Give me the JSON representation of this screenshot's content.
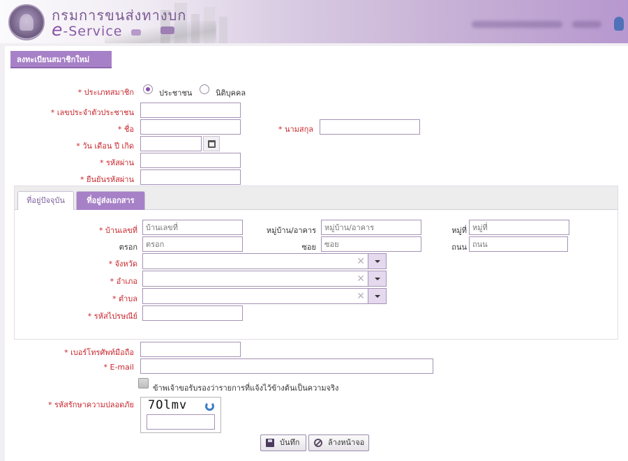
{
  "header": {
    "dept_name": "กรมการขนส่งทางบก",
    "service_prefix": "e",
    "service_suffix": "-Service"
  },
  "form": {
    "title": "ลงทะเบียนสมาชิกใหม่",
    "required_mark": "*",
    "member_type": {
      "label": "ประเภทสมาชิก",
      "options": [
        {
          "label": "ประชาชน",
          "selected": true
        },
        {
          "label": "นิติบุคคล",
          "selected": false
        }
      ]
    },
    "id_card": {
      "label": "เลขประจำตัวประชาชน",
      "value": ""
    },
    "first_name": {
      "label": "ชื่อ",
      "value": ""
    },
    "last_name": {
      "label": "นามสกุล",
      "value": ""
    },
    "birth_date": {
      "label": "วัน เดือน ปี เกิด",
      "value": ""
    },
    "password": {
      "label": "รหัสผ่าน",
      "value": ""
    },
    "confirm_password": {
      "label": "ยืนยันรหัสผ่าน",
      "value": ""
    }
  },
  "address": {
    "tabs": [
      {
        "label": "ที่อยู่ปัจจุบัน",
        "active": false
      },
      {
        "label": "ที่อยู่ส่งเอกสาร",
        "active": true
      }
    ],
    "house_no": {
      "label": "บ้านเลขที่",
      "placeholder": "บ้านเลขที่"
    },
    "village": {
      "label": "หมู่บ้าน/อาคาร",
      "placeholder": "หมู่บ้าน/อาคาร"
    },
    "moo": {
      "label": "หมู่ที่",
      "placeholder": "หมู่ที่"
    },
    "trok": {
      "label": "ตรอก",
      "placeholder": "ตรอก"
    },
    "soi": {
      "label": "ซอย",
      "placeholder": "ซอย"
    },
    "road": {
      "label": "ถนน",
      "placeholder": "ถนน"
    },
    "province": {
      "label": "จังหวัด"
    },
    "district": {
      "label": "อำเภอ"
    },
    "subdistrict": {
      "label": "ตำบล"
    },
    "postcode": {
      "label": "รหัสไปรษณีย์"
    },
    "clear_glyph": "✕"
  },
  "contact": {
    "mobile": {
      "label": "เบอร์โทรศัพท์มือถือ",
      "value": ""
    },
    "email": {
      "label": "E-mail",
      "value": ""
    },
    "certify": "ข้าพเจ้าขอรับรองว่ารายการที่แจ้งไว้ข้างต้นเป็นความจริง",
    "captcha_label": "รหัสรักษาความปลอดภัย",
    "captcha_text": "7Olmv"
  },
  "buttons": {
    "save": "บันทึก",
    "clear": "ล้างหน้าจอ"
  },
  "colors": {
    "accent": "#a781c7",
    "required": "#c8262c",
    "border": "#a592b5"
  }
}
